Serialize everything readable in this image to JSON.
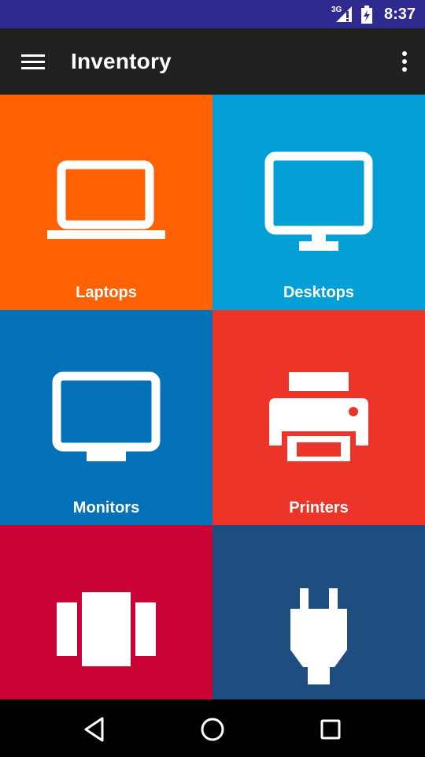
{
  "status_bar": {
    "time": "8:37",
    "network": "3G",
    "icons": [
      "signal-icon",
      "battery-icon"
    ]
  },
  "app_bar": {
    "title": "Inventory",
    "icons": [
      "menu-icon",
      "overflow-menu-icon"
    ]
  },
  "tiles": [
    {
      "label": "Laptops",
      "icon": "laptop-icon",
      "color": "#ff6103"
    },
    {
      "label": "Desktops",
      "icon": "desktop-icon",
      "color": "#059fd8"
    },
    {
      "label": "Monitors",
      "icon": "monitor-icon",
      "color": "#0471b8"
    },
    {
      "label": "Printers",
      "icon": "printer-icon",
      "color": "#ed3428"
    },
    {
      "label": "",
      "icon": "carousel-icon",
      "color": "#ca0236"
    },
    {
      "label": "",
      "icon": "plug-icon",
      "color": "#1d4e7f"
    }
  ],
  "nav_bar": {
    "icons": [
      "back-icon",
      "home-icon",
      "recents-icon"
    ]
  },
  "colors": {
    "status_bar": "#2f2a8f",
    "app_bar": "#212121",
    "nav_bar": "#000000"
  }
}
